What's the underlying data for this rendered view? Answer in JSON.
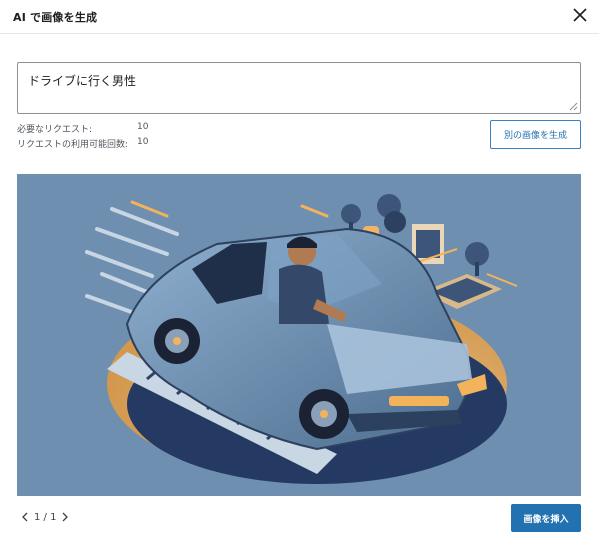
{
  "dialog": {
    "title": "AI で画像を生成"
  },
  "prompt": {
    "value": "ドライブに行く男性"
  },
  "stats": {
    "required_label": "必要なリクエスト:",
    "required_value": "10",
    "available_label": "リクエストの利用可能回数:",
    "available_value": "10"
  },
  "actions": {
    "regenerate_label": "別の画像を生成",
    "insert_label": "画像を挿入"
  },
  "pagination": {
    "text": "1 / 1"
  },
  "icons": {
    "close": "close-icon",
    "prev": "chevron-left-icon",
    "next": "chevron-right-icon",
    "resize": "resize-grip-icon"
  },
  "colors": {
    "accent": "#2271b1",
    "image_bg": "#6e8fb0"
  }
}
